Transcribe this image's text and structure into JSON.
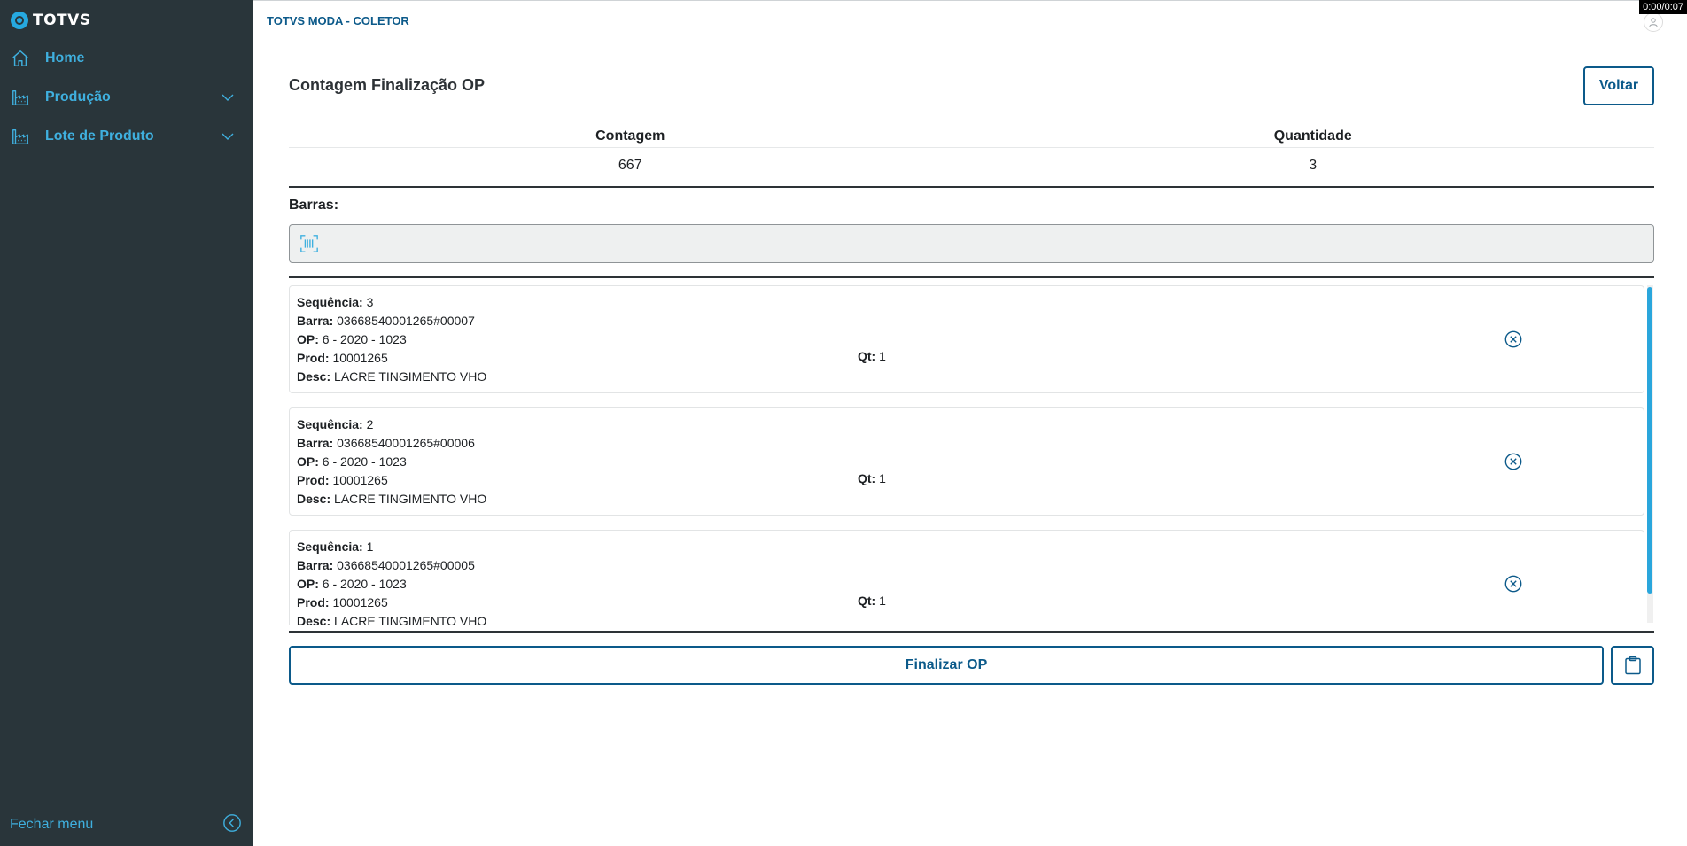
{
  "app": {
    "logo_text": "TOTVS",
    "title": "TOTVS MODA - COLETOR",
    "timer": "0:00/0:07"
  },
  "sidebar": {
    "items": [
      {
        "label": "Home",
        "icon": "home-icon",
        "expandable": false
      },
      {
        "label": "Produção",
        "icon": "factory-icon",
        "expandable": true
      },
      {
        "label": "Lote de Produto",
        "icon": "factory-icon",
        "expandable": true
      }
    ],
    "close_label": "Fechar menu"
  },
  "page": {
    "title": "Contagem Finalização OP",
    "back_label": "Voltar"
  },
  "summary": {
    "headers": [
      "Contagem",
      "Quantidade"
    ],
    "values": [
      "667",
      "3"
    ]
  },
  "barras": {
    "label": "Barras:",
    "value": "",
    "placeholder": ""
  },
  "fields": {
    "sequencia": "Sequência:",
    "barra": "Barra:",
    "op": "OP:",
    "prod": "Prod:",
    "desc": "Desc:",
    "qt": "Qt:"
  },
  "items": [
    {
      "sequencia": "3",
      "barra": "03668540001265#00007",
      "op": "6 - 2020 - 1023",
      "prod": "10001265",
      "desc": "LACRE TINGIMENTO VHO",
      "qt": "1"
    },
    {
      "sequencia": "2",
      "barra": "03668540001265#00006",
      "op": "6 - 2020 - 1023",
      "prod": "10001265",
      "desc": "LACRE TINGIMENTO VHO",
      "qt": "1"
    },
    {
      "sequencia": "1",
      "barra": "03668540001265#00005",
      "op": "6 - 2020 - 1023",
      "prod": "10001265",
      "desc": "LACRE TINGIMENTO VHO",
      "qt": "1"
    }
  ],
  "actions": {
    "finalize_label": "Finalizar OP",
    "clipboard_icon": "clipboard-icon"
  },
  "colors": {
    "sidebar_bg": "#29353a",
    "accent": "#3fb0df",
    "primary": "#0c5a8a"
  }
}
